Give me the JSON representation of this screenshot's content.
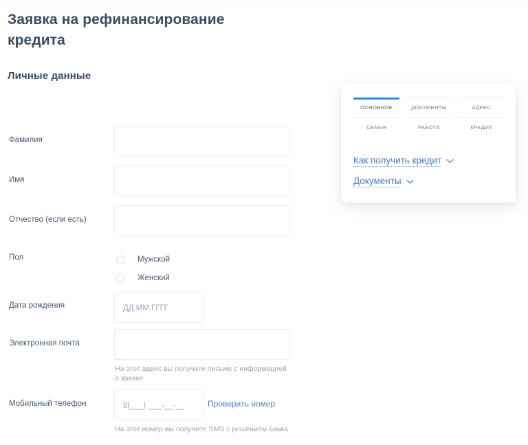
{
  "page": {
    "title": "Заявка на рефинансирование кредита",
    "section_title": "Личные данные"
  },
  "colors": {
    "accent": "#1f8bf5",
    "link": "#4d7bd6",
    "heading": "#3c4b63",
    "label": "#4a5a74",
    "hint": "#9aa5b8",
    "input_border": "#e8edf5"
  },
  "form": {
    "fields": [
      {
        "label": "Фамилия",
        "value": "",
        "placeholder": ""
      },
      {
        "label": "Имя",
        "value": "",
        "placeholder": ""
      },
      {
        "label": "Отчество (если есть)",
        "value": "",
        "placeholder": ""
      }
    ],
    "gender": {
      "label": "Пол",
      "options": [
        {
          "label": "Мужской",
          "selected": false
        },
        {
          "label": "Женский",
          "selected": false
        }
      ]
    },
    "birthdate": {
      "label": "Дата рождения",
      "value": "",
      "placeholder": "ДД.ММ.ГГГГ"
    },
    "email": {
      "label": "Электронная почта",
      "value": "",
      "placeholder": "",
      "hint": "На этот адрес вы получите письмо с информацией о заявке"
    },
    "phone": {
      "label": "Мобильный телефон",
      "value": "",
      "placeholder": "8(___) ___-__-__",
      "hint": "На этот номер вы получите SMS с решением банка",
      "check_link": "Проверить номер"
    }
  },
  "side_card": {
    "steps": [
      {
        "label": "ОСНОВНОЕ",
        "active": true
      },
      {
        "label": "ДОКУМЕНТЫ",
        "active": false
      },
      {
        "label": "АДРЕС",
        "active": false
      },
      {
        "label": "СЕМЬЯ",
        "active": false
      },
      {
        "label": "РАБОТА",
        "active": false
      },
      {
        "label": "КРЕДИТ",
        "active": false
      }
    ],
    "links": [
      {
        "label": "Как получить кредит"
      },
      {
        "label": "Документы"
      }
    ]
  }
}
